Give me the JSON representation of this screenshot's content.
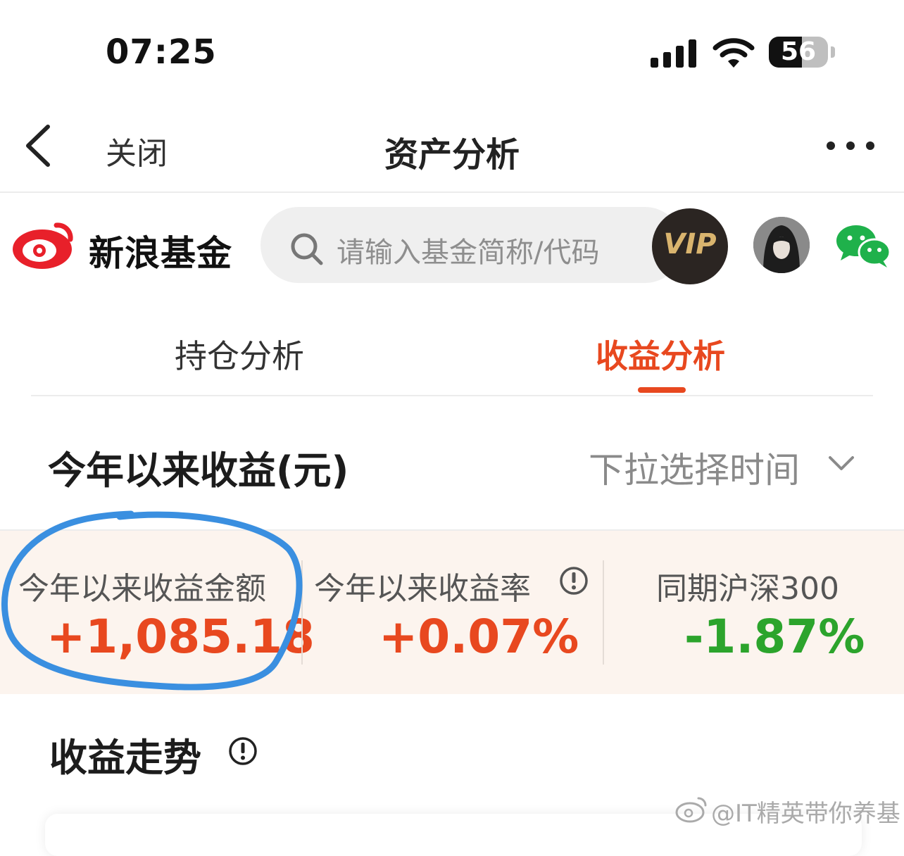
{
  "status_bar": {
    "time": "07:25",
    "battery_level": "56",
    "battery_fraction": 0.56
  },
  "nav": {
    "back_icon": "chevron-left-icon",
    "close_label": "关闭",
    "title": "资产分析",
    "more_icon": "more-dots-icon"
  },
  "header": {
    "brand_name": "新浪基金",
    "search_placeholder": "请输入基金简称/代码",
    "vip_label": "VIP"
  },
  "tabs": [
    {
      "label": "持仓分析",
      "active": false
    },
    {
      "label": "收益分析",
      "active": true
    }
  ],
  "ytd_section": {
    "title": "今年以来收益(元)",
    "time_select_label": "下拉选择时间"
  },
  "stats": [
    {
      "label": "今年以来收益金额",
      "value": "+1,085.18"
    },
    {
      "label": "今年以来收益率",
      "value": "+0.07%"
    },
    {
      "label": "同期沪深300",
      "value": "-1.87%"
    }
  ],
  "trend": {
    "title": "收益走势"
  },
  "watermark": "@IT精英带你养基",
  "colors": {
    "accent": "#e8481f",
    "positive": "#e8481f",
    "negative": "#2ca42c",
    "annotation": "#3a8fe0",
    "panel_bg": "#fcf4ee"
  }
}
